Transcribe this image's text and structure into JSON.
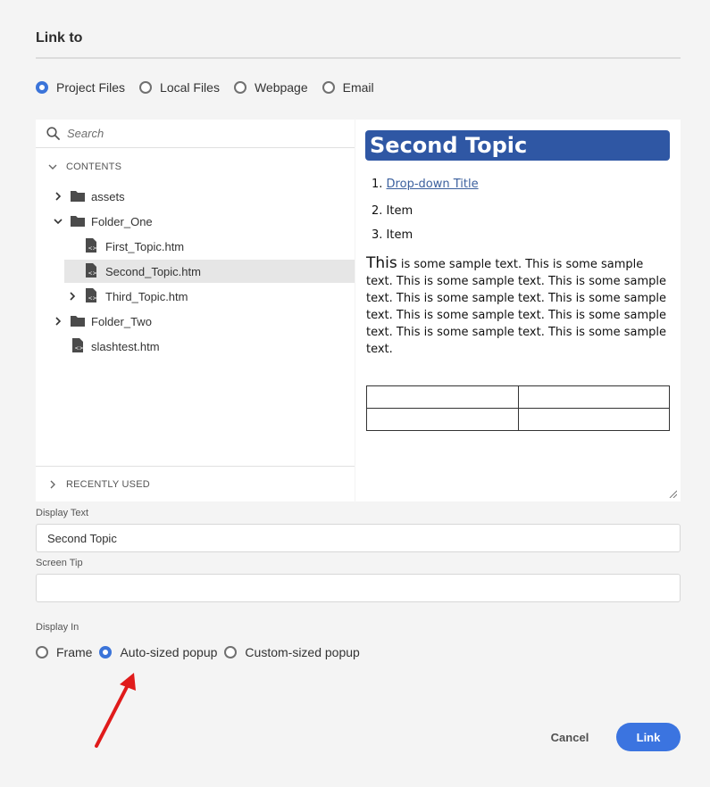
{
  "dialog": {
    "title": "Link to"
  },
  "link_type": {
    "options": [
      "Project Files",
      "Local Files",
      "Webpage",
      "Email"
    ],
    "selected": "Project Files"
  },
  "browser": {
    "search_placeholder": "Search",
    "contents_label": "CONTENTS",
    "recent_label": "RECENTLY USED",
    "tree": [
      {
        "label": "assets",
        "type": "folder",
        "expanded": false
      },
      {
        "label": "Folder_One",
        "type": "folder",
        "expanded": true
      },
      {
        "label": "First_Topic.htm",
        "type": "file"
      },
      {
        "label": "Second_Topic.htm",
        "type": "file",
        "selected": true
      },
      {
        "label": "Third_Topic.htm",
        "type": "file",
        "expandable": true
      },
      {
        "label": "Folder_Two",
        "type": "folder",
        "expanded": false
      },
      {
        "label": "slashtest.htm",
        "type": "file"
      }
    ]
  },
  "preview": {
    "title": "Second Topic",
    "list": [
      "Drop-down Title",
      "Item",
      "Item"
    ],
    "list_numbers": [
      "1.",
      "2.",
      "3."
    ],
    "para_first_word": "This",
    "para_rest": " is some sample text. This is some sample text. This is some sample text. This is some sample text. This is some sample text. This is some sample text. This is some sample text. This is some sample text. This is some sample text. This is some sample text."
  },
  "fields": {
    "display_text_label": "Display Text",
    "display_text_value": "Second Topic",
    "screen_tip_label": "Screen Tip",
    "screen_tip_value": ""
  },
  "display_in": {
    "label": "Display In",
    "options": [
      "Frame",
      "Auto-sized popup",
      "Custom-sized popup"
    ],
    "selected": "Auto-sized popup"
  },
  "buttons": {
    "cancel": "Cancel",
    "link": "Link"
  },
  "colors": {
    "accent": "#3b74e0",
    "preview_title_bg": "#2f57a4",
    "annotation_arrow": "#e01b1b"
  }
}
